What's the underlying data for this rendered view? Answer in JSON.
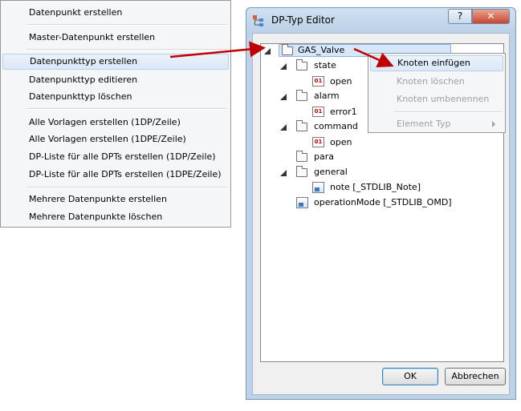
{
  "context_menu": {
    "items": [
      {
        "label": "Datenpunkt erstellen"
      },
      {
        "label": "Master-Datenpunkt erstellen"
      },
      {
        "label": "Datenpunkttyp erstellen"
      },
      {
        "label": "Datenpunkttyp editieren"
      },
      {
        "label": "Datenpunkttyp löschen"
      },
      {
        "label": "Alle Vorlagen erstellen (1DP/Zeile)"
      },
      {
        "label": "Alle Vorlagen erstellen (1DPE/Zeile)"
      },
      {
        "label": "DP-Liste für alle DPTs erstellen (1DP/Zeile)"
      },
      {
        "label": "DP-Liste für alle DPTs erstellen (1DPE/Zeile)"
      },
      {
        "label": "Mehrere Datenpunkte erstellen"
      },
      {
        "label": "Mehrere Datenpunkte löschen"
      }
    ],
    "highlighted": "Datenpunkttyp erstellen"
  },
  "editor": {
    "title": "DP-Typ Editor",
    "help_label": "?",
    "close_label": "✕",
    "tree": {
      "root": "GAS_Valve",
      "nodes": {
        "state": "state",
        "state_open": "open",
        "alarm": "alarm",
        "alarm_error": "error1",
        "command": "command",
        "command_open": "open",
        "para": "para",
        "general": "general",
        "general_note": "note [_STDLIB_Note]",
        "operation_mode": "operationMode [_STDLIB_OMD]"
      },
      "leaf_icon_text": "01"
    },
    "ok_label": "OK",
    "cancel_label": "Abbrechen"
  },
  "popup_menu": {
    "insert": "Knoten einfügen",
    "delete": "Knoten löschen",
    "rename": "Knoten umbenennen",
    "element_type": "Element Typ"
  },
  "colors": {
    "arrow": "#c00000",
    "selection": "#d6e7fa",
    "window_frame": "#bcd2e8"
  }
}
